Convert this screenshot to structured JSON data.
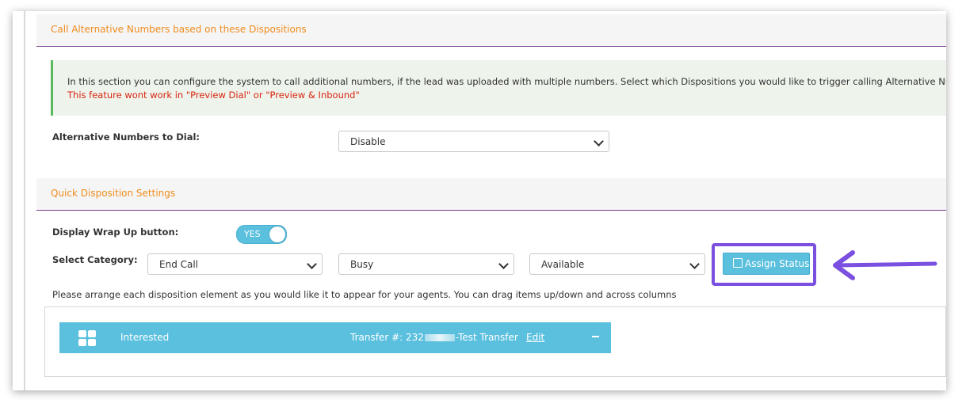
{
  "section1": {
    "title": "Call Alternative Numbers based on these Dispositions"
  },
  "info": {
    "text": "In this section you can configure the system to call additional numbers, if the lead was uploaded with multiple numbers. Select which Dispositions you would like to trigger calling Alternative Numbers.",
    "warning": "This feature wont work in \"Preview Dial\" or \"Preview & Inbound\""
  },
  "alt_numbers": {
    "label": "Alternative Numbers to Dial:",
    "value": "Disable"
  },
  "section2": {
    "title": "Quick Disposition Settings"
  },
  "wrap_up": {
    "label": "Display Wrap Up button:",
    "toggle_text": "YES"
  },
  "category": {
    "label": "Select Category:",
    "select1": "End Call",
    "select2": "Busy",
    "select3": "Available",
    "assign_label": "Assign Status"
  },
  "hint": "Please arrange each disposition element as you would like it to appear for your agents. You can drag items up/down and across columns",
  "disposition": {
    "name": "Interested",
    "transfer_prefix": "Transfer #: 232",
    "transfer_suffix": "-Test Transfer",
    "edit": "Edit"
  },
  "colors": {
    "accent_orange": "#ef8c1e",
    "info_blue": "#5bc0de",
    "highlight_purple": "#7b4fe0",
    "warning_red": "#d9230f"
  }
}
